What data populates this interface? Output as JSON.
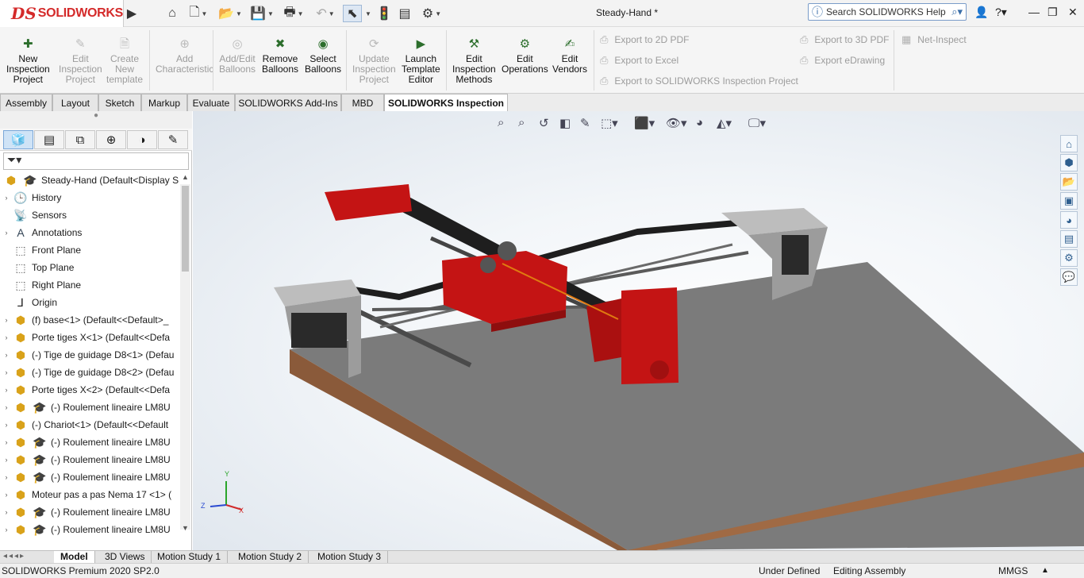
{
  "app": {
    "brand_ds": "DS",
    "brand_name": "SOLIDWORKS",
    "doc_title": "Steady-Hand *"
  },
  "search": {
    "placeholder": "Search SOLIDWORKS Help"
  },
  "ribbon": {
    "buttons": [
      {
        "label1": "New",
        "label2": "Inspection",
        "label3": "Project",
        "enabled": true
      },
      {
        "label1": "Edit",
        "label2": "Inspection",
        "label3": "Project",
        "enabled": false
      },
      {
        "label1": "Create",
        "label2": "New",
        "label3": "template",
        "enabled": false
      },
      {
        "label1": "Add",
        "label2": "Characteristic",
        "label3": "",
        "enabled": false
      },
      {
        "label1": "Add/Edit",
        "label2": "Balloons",
        "label3": "",
        "enabled": false
      },
      {
        "label1": "Remove",
        "label2": "Balloons",
        "label3": "",
        "enabled": true
      },
      {
        "label1": "Select",
        "label2": "Balloons",
        "label3": "",
        "enabled": true
      },
      {
        "label1": "Update",
        "label2": "Inspection",
        "label3": "Project",
        "enabled": false
      },
      {
        "label1": "Launch",
        "label2": "Template",
        "label3": "Editor",
        "enabled": true
      },
      {
        "label1": "Edit",
        "label2": "Inspection",
        "label3": "Methods",
        "enabled": true
      },
      {
        "label1": "Edit",
        "label2": "Operations",
        "label3": "",
        "enabled": true
      },
      {
        "label1": "Edit",
        "label2": "Vendors",
        "label3": "",
        "enabled": true
      }
    ],
    "exports": [
      "Export to 2D PDF",
      "Export to Excel",
      "Export to SOLIDWORKS Inspection Project",
      "Export to 3D PDF",
      "Export eDrawing",
      "Net-Inspect"
    ]
  },
  "tabs": [
    "Assembly",
    "Layout",
    "Sketch",
    "Markup",
    "Evaluate",
    "SOLIDWORKS Add-Ins",
    "MBD",
    "SOLIDWORKS Inspection"
  ],
  "active_tab": "SOLIDWORKS Inspection",
  "tree": {
    "root": "Steady-Hand  (Default<Display S",
    "items": [
      {
        "label": "History",
        "arrow": true,
        "icon": "history-icon",
        "sub": false
      },
      {
        "label": "Sensors",
        "arrow": false,
        "icon": "sensor-icon",
        "sub": false
      },
      {
        "label": "Annotations",
        "arrow": true,
        "icon": "annotation-icon",
        "sub": false
      },
      {
        "label": "Front Plane",
        "arrow": false,
        "icon": "plane-icon",
        "sub": false
      },
      {
        "label": "Top Plane",
        "arrow": false,
        "icon": "plane-icon",
        "sub": false
      },
      {
        "label": "Right Plane",
        "arrow": false,
        "icon": "plane-icon",
        "sub": false
      },
      {
        "label": "Origin",
        "arrow": false,
        "icon": "origin-icon",
        "sub": false
      },
      {
        "label": "(f) base<1> (Default<<Default>_",
        "arrow": true,
        "icon": "part-icon",
        "sub": false
      },
      {
        "label": "Porte tiges X<1> (Default<<Defa",
        "arrow": true,
        "icon": "part-icon",
        "sub": false
      },
      {
        "label": "(-) Tige de guidage D8<1> (Defau",
        "arrow": true,
        "icon": "part-icon",
        "sub": false
      },
      {
        "label": "(-) Tige de guidage D8<2> (Defau",
        "arrow": true,
        "icon": "part-icon",
        "sub": false
      },
      {
        "label": "Porte tiges X<2> (Default<<Defa",
        "arrow": true,
        "icon": "part-icon",
        "sub": false
      },
      {
        "label": "(-) Roulement lineaire LM8U",
        "arrow": true,
        "icon": "part-icon",
        "sub": true
      },
      {
        "label": "(-) Chariot<1> (Default<<Default",
        "arrow": true,
        "icon": "part-icon",
        "sub": false
      },
      {
        "label": "(-) Roulement lineaire LM8U",
        "arrow": true,
        "icon": "part-icon",
        "sub": true
      },
      {
        "label": "(-) Roulement lineaire LM8U",
        "arrow": true,
        "icon": "part-icon",
        "sub": true
      },
      {
        "label": "(-) Roulement lineaire LM8U",
        "arrow": true,
        "icon": "part-icon",
        "sub": true
      },
      {
        "label": "Moteur pas a pas Nema 17  <1> (",
        "arrow": true,
        "icon": "part-icon",
        "sub": false
      },
      {
        "label": "(-) Roulement lineaire LM8U",
        "arrow": true,
        "icon": "part-icon",
        "sub": true
      },
      {
        "label": "(-) Roulement lineaire LM8U",
        "arrow": true,
        "icon": "part-icon",
        "sub": true
      }
    ]
  },
  "bottom_tabs": [
    "Model",
    "3D Views",
    "Motion Study 1",
    "Motion Study 2",
    "Motion Study 3"
  ],
  "status": {
    "left": "SOLIDWORKS Premium 2020 SP2.0",
    "state": "Under Defined",
    "mode": "Editing Assembly",
    "units": "MMGS"
  },
  "triad": {
    "y": "Y",
    "z": "Z",
    "x": "X"
  },
  "colors": {
    "accent": "#d42a2a",
    "part_red": "#c41414",
    "plate_gray": "#7a7a7a",
    "wood": "#8a5a3a"
  }
}
